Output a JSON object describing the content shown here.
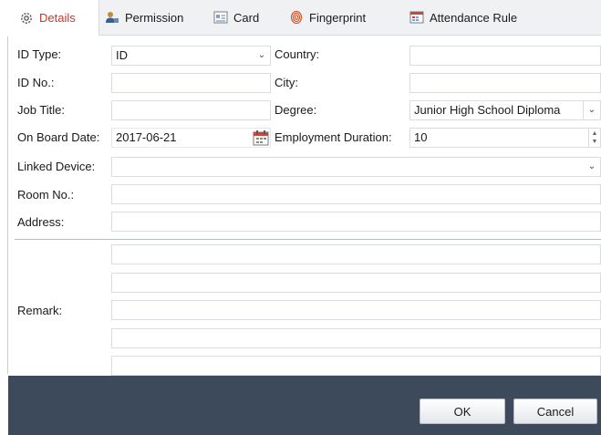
{
  "tabs": [
    {
      "label": "Details",
      "icon": "gear-icon",
      "active": true
    },
    {
      "label": "Permission",
      "icon": "user-key-icon",
      "active": false
    },
    {
      "label": "Card",
      "icon": "card-icon",
      "active": false
    },
    {
      "label": "Fingerprint",
      "icon": "fingerprint-icon",
      "active": false
    },
    {
      "label": "Attendance Rule",
      "icon": "calendar-rule-icon",
      "active": false
    }
  ],
  "form": {
    "id_type": {
      "label": "ID Type:",
      "value": "ID"
    },
    "country": {
      "label": "Country:",
      "value": ""
    },
    "id_no": {
      "label": "ID No.:",
      "value": ""
    },
    "city": {
      "label": "City:",
      "value": ""
    },
    "job_title": {
      "label": "Job Title:",
      "value": ""
    },
    "degree": {
      "label": "Degree:",
      "value": "Junior High School Diploma"
    },
    "on_board_date": {
      "label": "On Board Date:",
      "value": "2017-06-21"
    },
    "employment_duration": {
      "label": "Employment Duration:",
      "value": "10"
    },
    "linked_device": {
      "label": "Linked Device:",
      "value": ""
    },
    "room_no": {
      "label": "Room No.:",
      "value": ""
    },
    "address": {
      "label": "Address:",
      "value": ""
    },
    "remark": {
      "label": "Remark:",
      "lines": [
        "",
        "",
        "",
        "",
        ""
      ]
    }
  },
  "footer": {
    "ok_label": "OK",
    "cancel_label": "Cancel"
  },
  "colors": {
    "active_tab_text": "#c0392b",
    "footer_bg": "#3d4a5c"
  }
}
